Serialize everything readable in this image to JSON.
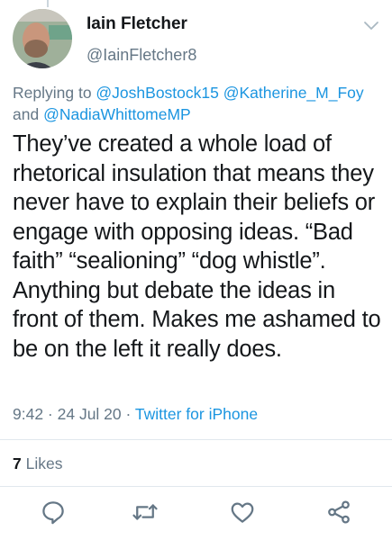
{
  "tweet": {
    "author_name": "Iain Fletcher",
    "author_handle": "@IainFletcher8",
    "reply_prefix": "Replying to ",
    "reply_mentions": [
      "@JoshBostock15",
      "@Katherine_M_Foy",
      "@NadiaWhittomeMP"
    ],
    "reply_joiner": "and ",
    "text": "They’ve created a whole load of rhetorical insulation that means they never have to explain their beliefs or engage with opposing ideas. “Bad faith” “sealioning” “dog whistle”. Anything but debate the ideas in front of them. Makes me ashamed to be on the left it really does.",
    "time": "9:42",
    "date": "24 Jul 20",
    "separator": " · ",
    "source": "Twitter for iPhone",
    "likes_count": "7",
    "likes_label": " Likes"
  },
  "actions": {
    "reply_icon": "reply-icon",
    "retweet_icon": "retweet-icon",
    "like_icon": "heart-icon",
    "share_icon": "share-icon"
  },
  "colors": {
    "link": "#1b95e0",
    "secondary_text": "#657786",
    "primary_text": "#14171a",
    "divider": "#e1e8ed"
  }
}
